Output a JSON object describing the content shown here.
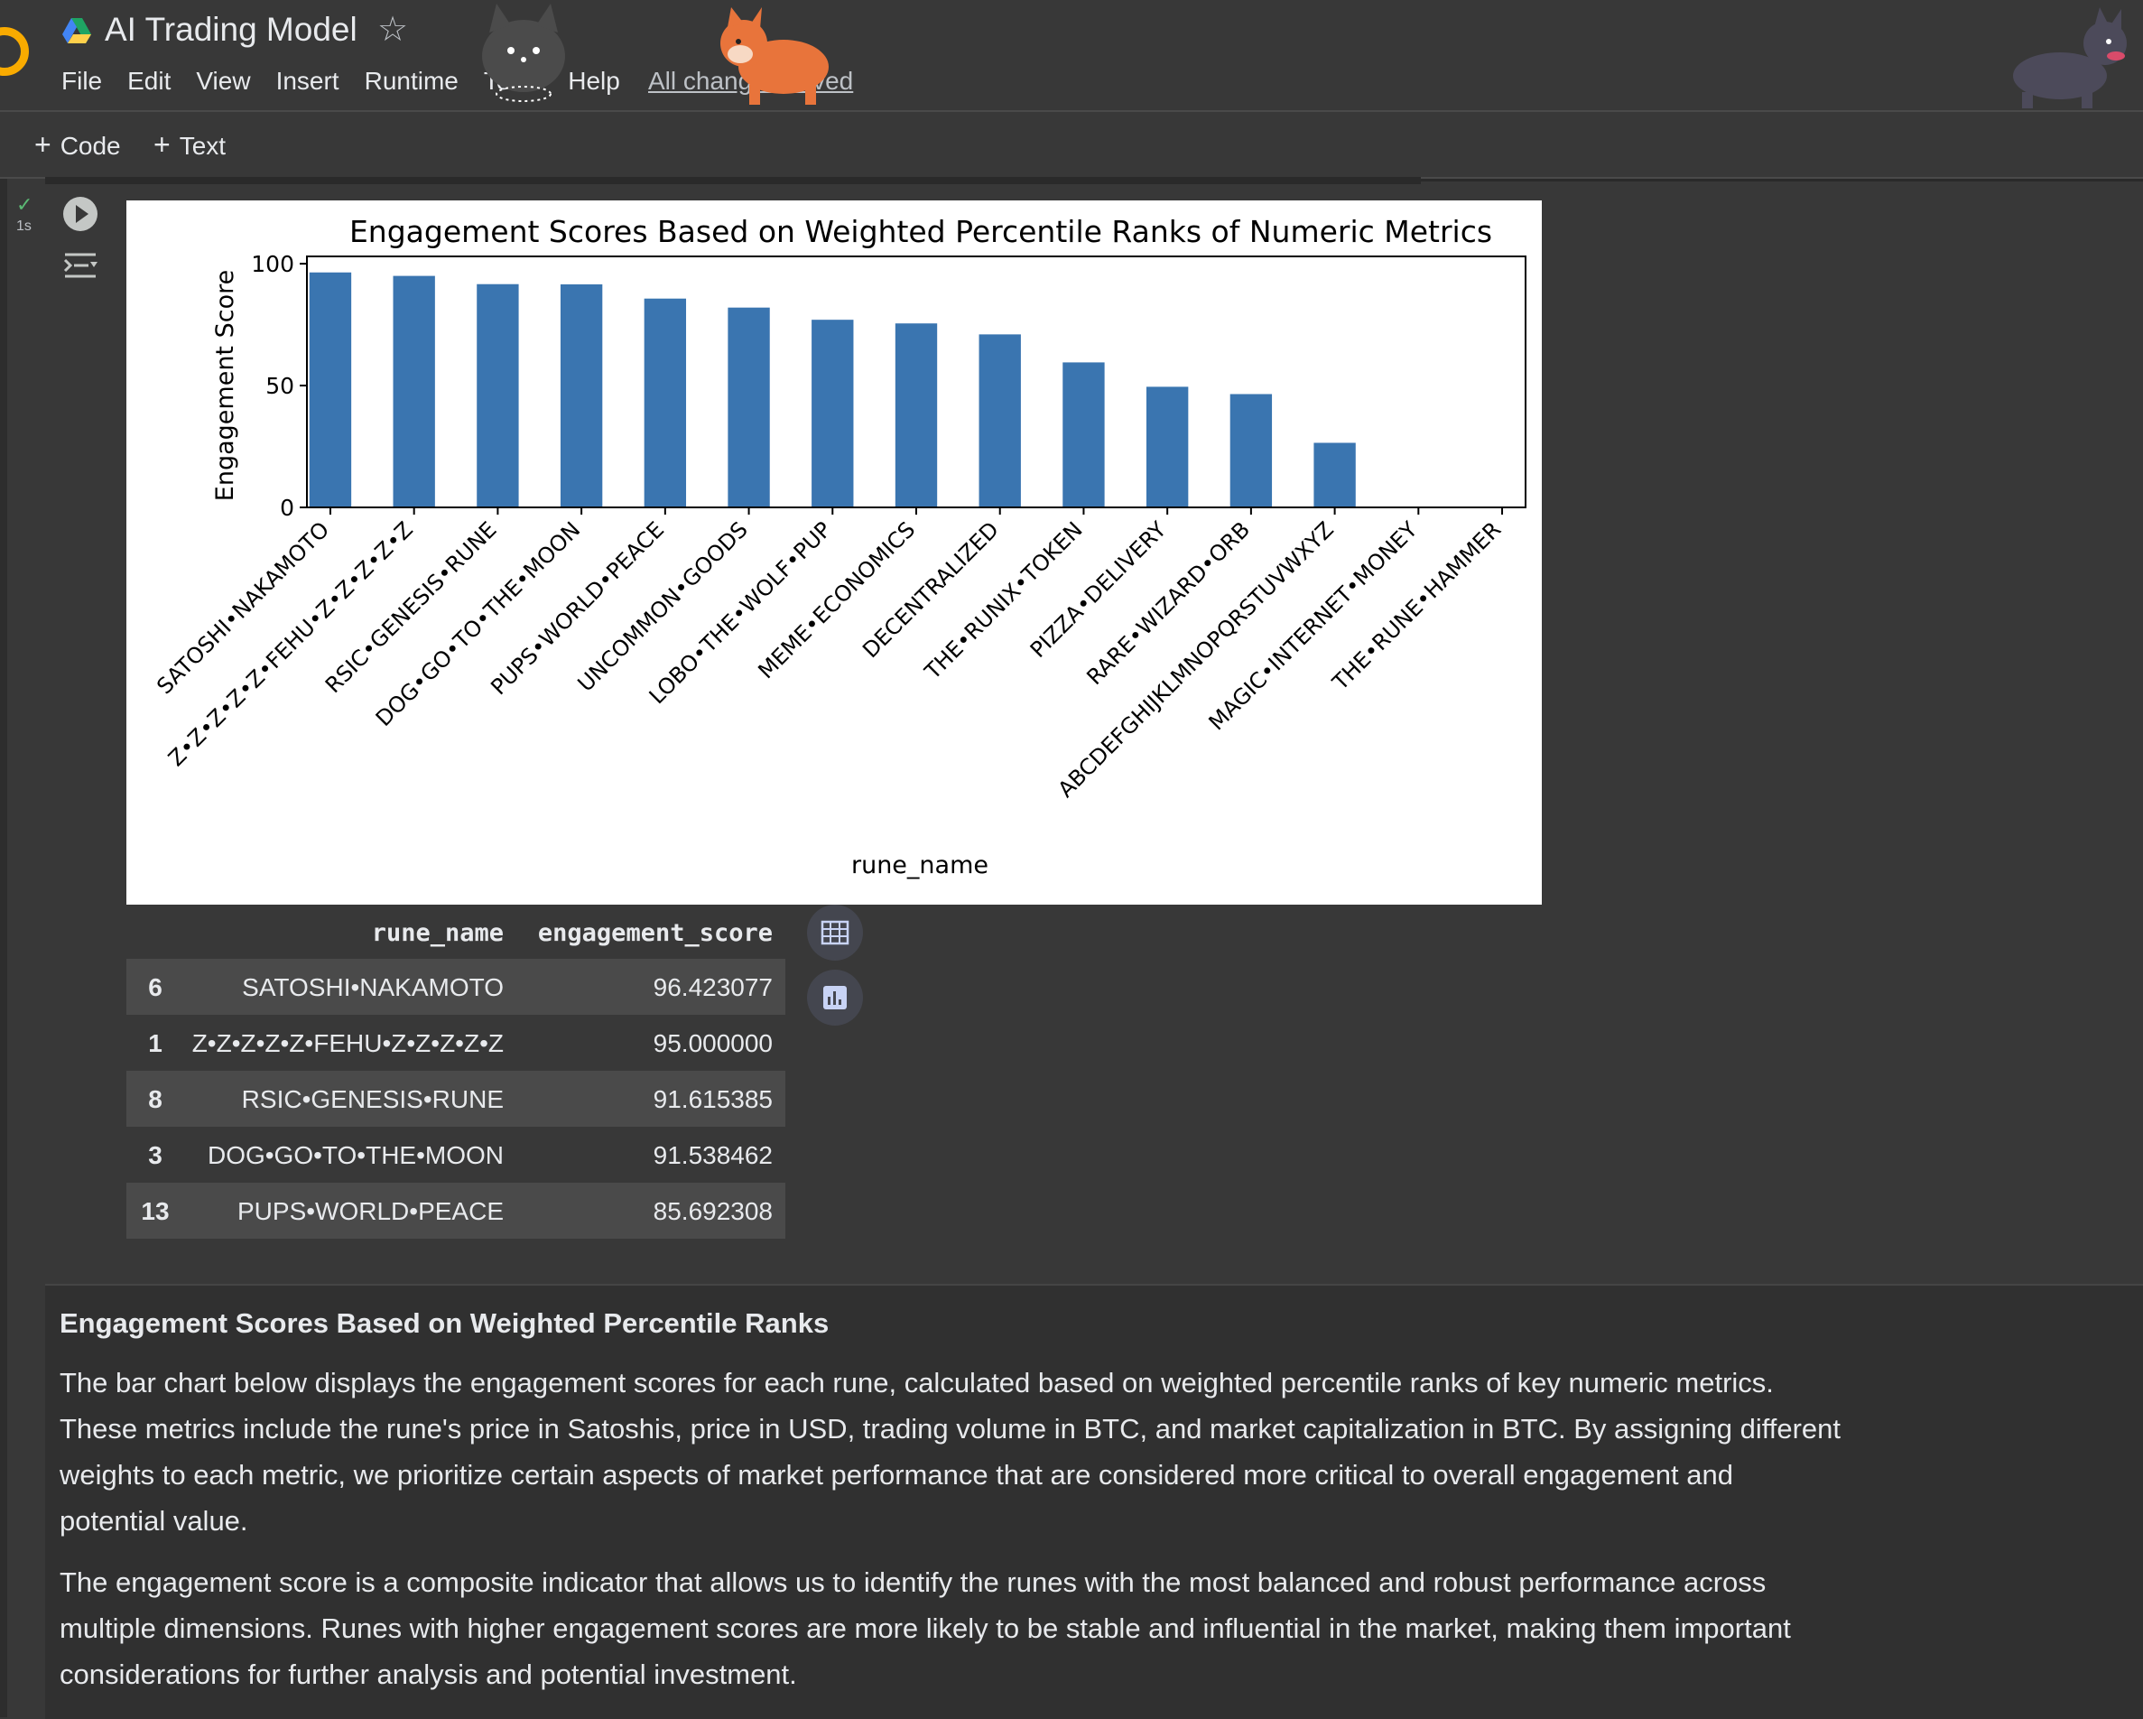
{
  "header": {
    "title": "AI Trading Model",
    "menu": [
      "File",
      "Edit",
      "View",
      "Insert",
      "Runtime",
      "Tools",
      "Help"
    ],
    "save_status": "All changes saved"
  },
  "toolbar": {
    "add_code": "Code",
    "add_text": "Text"
  },
  "cell": {
    "status": "✓",
    "runtime": "1s"
  },
  "chart_data": {
    "type": "bar",
    "title": "Engagement Scores Based on Weighted Percentile Ranks of Numeric Metrics",
    "xlabel": "rune_name",
    "ylabel": "Engagement Score",
    "ylim": [
      0,
      103
    ],
    "yticks": [
      0,
      50,
      100
    ],
    "bar_color": "#3a75b0",
    "categories": [
      "SATOSHI•NAKAMOTO",
      "Z•Z•Z•Z•Z•FEHU•Z•Z•Z•Z•Z",
      "RSIC•GENESIS•RUNE",
      "DOG•GO•TO•THE•MOON",
      "PUPS•WORLD•PEACE",
      "UNCOMMON•GOODS",
      "LOBO•THE•WOLF•PUP",
      "MEME•ECONOMICS",
      "DECENTRALIZED",
      "THE•RUNIX•TOKEN",
      "PIZZA•DELIVERY",
      "RARE•WIZARD•ORB",
      "ABCDEFGHIJKLMNOPQRSTUVWXYZ",
      "MAGIC•INTERNET•MONEY",
      "THE•RUNE•HAMMER"
    ],
    "values": [
      96.423077,
      95.0,
      91.615385,
      91.538462,
      85.692308,
      82.0,
      77.0,
      75.5,
      71.0,
      59.5,
      49.5,
      46.5,
      26.5,
      0,
      0
    ]
  },
  "dataframe": {
    "columns": [
      "rune_name",
      "engagement_score"
    ],
    "rows": [
      {
        "index": "6",
        "rune_name": "SATOSHI•NAKAMOTO",
        "engagement_score": "96.423077"
      },
      {
        "index": "1",
        "rune_name": "Z•Z•Z•Z•Z•FEHU•Z•Z•Z•Z•Z",
        "engagement_score": "95.000000"
      },
      {
        "index": "8",
        "rune_name": "RSIC•GENESIS•RUNE",
        "engagement_score": "91.615385"
      },
      {
        "index": "3",
        "rune_name": "DOG•GO•TO•THE•MOON",
        "engagement_score": "91.538462"
      },
      {
        "index": "13",
        "rune_name": "PUPS•WORLD•PEACE",
        "engagement_score": "85.692308"
      }
    ]
  },
  "markdown": {
    "heading": "Engagement Scores Based on Weighted Percentile Ranks",
    "para1_lines": [
      "The bar chart below displays the engagement scores for each rune, calculated based on weighted percentile ranks of key numeric metrics.",
      "These metrics include the rune's price in Satoshis, price in USD, trading volume in BTC, and market capitalization in BTC. By assigning different",
      "weights to each metric, we prioritize certain aspects of market performance that are considered more critical to overall engagement and",
      "potential value."
    ],
    "para2_lines": [
      "The engagement score is a composite indicator that allows us to identify the runes with the most balanced and robust performance across",
      "multiple dimensions. Runes with higher engagement scores are more likely to be stable and influential in the market, making them important",
      "considerations for further analysis and potential investment."
    ]
  }
}
